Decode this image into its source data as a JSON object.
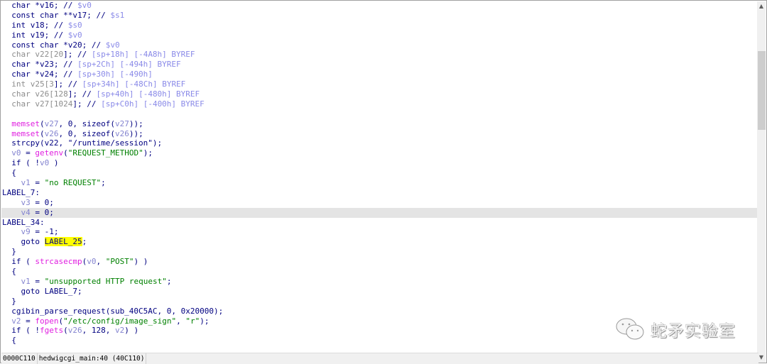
{
  "code": {
    "highlight_line": 21,
    "lines": [
      [
        [
          "  char *v16; // ",
          "k"
        ],
        [
          "$v0",
          "c"
        ]
      ],
      [
        [
          "  const char **v17; // ",
          "k"
        ],
        [
          "$s1",
          "c"
        ]
      ],
      [
        [
          "  int v18; // ",
          "k"
        ],
        [
          "$s0",
          "c"
        ]
      ],
      [
        [
          "  int v19; // ",
          "k"
        ],
        [
          "$v0",
          "c"
        ]
      ],
      [
        [
          "  const char *v20; // ",
          "k"
        ],
        [
          "$v0",
          "c"
        ]
      ],
      [
        [
          "  char v22[20",
          "g"
        ],
        [
          "]; // ",
          "k"
        ],
        [
          "[sp+18h] [-4A8h] BYREF",
          "c"
        ]
      ],
      [
        [
          "  char *v23; // ",
          "k"
        ],
        [
          "[sp+2Ch] [-494h] BYREF",
          "c"
        ]
      ],
      [
        [
          "  char *v24; // ",
          "k"
        ],
        [
          "[sp+30h] [-490h]",
          "c"
        ]
      ],
      [
        [
          "  int v25[3",
          "g"
        ],
        [
          "]; // ",
          "k"
        ],
        [
          "[sp+34h] [-48Ch] BYREF",
          "c"
        ]
      ],
      [
        [
          "  char v26[128",
          "g"
        ],
        [
          "]; // ",
          "k"
        ],
        [
          "[sp+40h] [-480h] BYREF",
          "c"
        ]
      ],
      [
        [
          "  char v27[1024",
          "g"
        ],
        [
          "]; // ",
          "k"
        ],
        [
          "[sp+C0h] [-400h] BYREF",
          "c"
        ]
      ],
      [
        [
          "",
          ""
        ]
      ],
      [
        [
          "  ",
          "k"
        ],
        [
          "memset",
          "f"
        ],
        [
          "(",
          "k"
        ],
        [
          "v27",
          "v"
        ],
        [
          ", 0, sizeof(",
          "k"
        ],
        [
          "v27",
          "v"
        ],
        [
          "));",
          "k"
        ]
      ],
      [
        [
          "  ",
          "k"
        ],
        [
          "memset",
          "f"
        ],
        [
          "(",
          "k"
        ],
        [
          "v26",
          "v"
        ],
        [
          ", 0, sizeof(",
          "k"
        ],
        [
          "v26",
          "v"
        ],
        [
          "));",
          "k"
        ]
      ],
      [
        [
          "  strcpy(v22, \"/runtime/session\");",
          "k"
        ]
      ],
      [
        [
          "  ",
          "k"
        ],
        [
          "v0",
          "v"
        ],
        [
          " = ",
          "k"
        ],
        [
          "getenv",
          "f"
        ],
        [
          "(",
          "k"
        ],
        [
          "\"REQUEST_METHOD\"",
          "s"
        ],
        [
          ");",
          "k"
        ]
      ],
      [
        [
          "  if ( !",
          "k"
        ],
        [
          "v0",
          "v"
        ],
        [
          " )",
          "k"
        ]
      ],
      [
        [
          "  {",
          "k"
        ]
      ],
      [
        [
          "    ",
          "k"
        ],
        [
          "v1",
          "v"
        ],
        [
          " = ",
          "k"
        ],
        [
          "\"no REQUEST\"",
          "s"
        ],
        [
          ";",
          "k"
        ]
      ],
      [
        [
          "LABEL_7:",
          "k"
        ]
      ],
      [
        [
          "    ",
          "k"
        ],
        [
          "v3",
          "v"
        ],
        [
          " = 0;",
          "k"
        ]
      ],
      [
        [
          "    ",
          "k"
        ],
        [
          "v4",
          "v"
        ],
        [
          " = 0;",
          "k"
        ]
      ],
      [
        [
          "LABEL_34:",
          "k"
        ]
      ],
      [
        [
          "    ",
          "k"
        ],
        [
          "v9",
          "v"
        ],
        [
          " = -1;",
          "k"
        ]
      ],
      [
        [
          "    goto ",
          "k"
        ],
        [
          "LABEL_25",
          "y"
        ],
        [
          ";",
          "k"
        ]
      ],
      [
        [
          "  }",
          "k"
        ]
      ],
      [
        [
          "  if ( ",
          "k"
        ],
        [
          "strcasecmp",
          "f"
        ],
        [
          "(",
          "k"
        ],
        [
          "v0",
          "v"
        ],
        [
          ", ",
          "k"
        ],
        [
          "\"POST\"",
          "s"
        ],
        [
          ") )",
          "k"
        ]
      ],
      [
        [
          "  {",
          "k"
        ]
      ],
      [
        [
          "    ",
          "k"
        ],
        [
          "v1",
          "v"
        ],
        [
          " = ",
          "k"
        ],
        [
          "\"unsupported HTTP request\"",
          "s"
        ],
        [
          ";",
          "k"
        ]
      ],
      [
        [
          "    goto LABEL_7;",
          "k"
        ]
      ],
      [
        [
          "  }",
          "k"
        ]
      ],
      [
        [
          "  cgibin_parse_request(sub_40C5AC, 0, 0x20000);",
          "k"
        ]
      ],
      [
        [
          "  ",
          "k"
        ],
        [
          "v2",
          "v"
        ],
        [
          " = ",
          "k"
        ],
        [
          "fopen",
          "f"
        ],
        [
          "(",
          "k"
        ],
        [
          "\"/etc/config/image_sign\"",
          "s"
        ],
        [
          ", ",
          "k"
        ],
        [
          "\"r\"",
          "s"
        ],
        [
          ");",
          "k"
        ]
      ],
      [
        [
          "  if ( !",
          "k"
        ],
        [
          "fgets",
          "f"
        ],
        [
          "(",
          "k"
        ],
        [
          "v26",
          "v"
        ],
        [
          ", 128, ",
          "k"
        ],
        [
          "v2",
          "v"
        ],
        [
          ") )",
          "k"
        ]
      ],
      [
        [
          "  {",
          "k"
        ]
      ]
    ]
  },
  "status_bar": {
    "offset": "0000C110",
    "location": "hedwigcgi_main:40 (40C110)"
  },
  "scrollbar": {
    "up_icon": "chevron-up-icon",
    "down_icon": "chevron-down-icon"
  },
  "watermark": {
    "text": "蛇矛实验室",
    "icon": "wechat-icon"
  }
}
